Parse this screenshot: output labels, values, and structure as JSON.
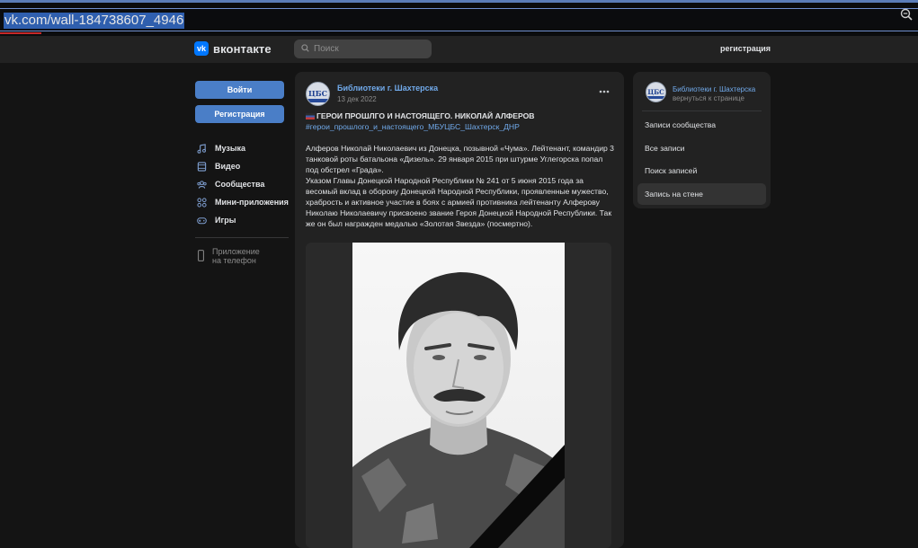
{
  "browser": {
    "url": "vk.com/wall-184738607_4946"
  },
  "header": {
    "logo_text": "вконтакте",
    "logo_mark": "vk",
    "search_placeholder": "Поиск",
    "register_link": "регистрация"
  },
  "sidebar": {
    "login_button": "Войти",
    "register_button": "Регистрация",
    "items": [
      {
        "label": "Музыка",
        "icon": "music-icon"
      },
      {
        "label": "Видео",
        "icon": "video-icon"
      },
      {
        "label": "Сообщества",
        "icon": "communities-icon"
      },
      {
        "label": "Мини-приложения",
        "icon": "mini-apps-icon"
      },
      {
        "label": "Игры",
        "icon": "games-icon"
      }
    ],
    "app_line1": "Приложение",
    "app_line2": "на телефон"
  },
  "post": {
    "author": "Библиотеки г. Шахтерска",
    "date": "13 дек 2022",
    "avatar_text": "ЦБС",
    "title": "ГЕРОИ ПРОШЛГО И НАСТОЯЩЕГО. НИКОЛАЙ АЛФЕРОВ",
    "hashtag": "#герои_прошлого_и_настоящего_МБУЦБС_Шахтерск_ДНР",
    "paragraph1": "Алферов Николай Николаевич из Донецка, позывной «Чума». Лейтенант, командир 3 танковой роты батальона «Дизель». 29 января 2015 при штурме Углегорска попал под обстрел «Града».",
    "paragraph2": "Указом Главы Донецкой Народной Республики № 241 от 5 июня 2015 года за весомый вклад в оборону Донецкой Народной Республики, проявленные мужество, храбрость и активное участие в боях с армией противника лейтенанту Алферову Николаю Николаевичу присвоено звание Героя Донецкой Народной Республики. Так же он был награжден медалью «Золотая Звезда» (посмертно)."
  },
  "right_panel": {
    "group_name": "Библиотеки г. Шахтерска",
    "back_link": "вернуться к странице",
    "avatar_text": "ЦБС",
    "menu": [
      {
        "label": "Записи сообщества",
        "active": false
      },
      {
        "label": "Все записи",
        "active": false
      },
      {
        "label": "Поиск записей",
        "active": false
      },
      {
        "label": "Запись на стене",
        "active": true
      }
    ]
  },
  "colors": {
    "accent": "#71aaeb",
    "button": "#4a7ec7",
    "background": "#141414",
    "card": "#222222"
  }
}
